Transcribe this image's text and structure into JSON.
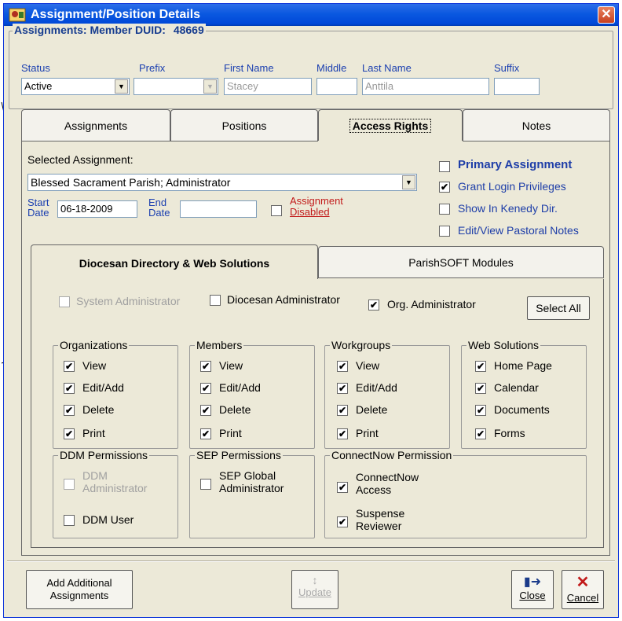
{
  "window": {
    "title": "Assignment/Position Details"
  },
  "header": {
    "member_label": "Assignments: Member DUID:",
    "duid": "48669",
    "status_label": "Status",
    "status_value": "Active",
    "prefix_label": "Prefix",
    "prefix_value": "",
    "first_name_label": "First Name",
    "first_name_value": "Stacey",
    "middle_label": "Middle",
    "middle_value": "",
    "last_name_label": "Last Name",
    "last_name_value": "Anttila",
    "suffix_label": "Suffix",
    "suffix_value": ""
  },
  "tabs": [
    "Assignments",
    "Positions",
    "Access Rights",
    "Notes"
  ],
  "access": {
    "selected_assignment_label": "Selected Assignment:",
    "selected_assignment_value": "Blessed Sacrament Parish; Administrator",
    "start_label_1": "Start",
    "start_label_2": "Date",
    "start_value": "06-18-2009",
    "end_label_1": "End",
    "end_label_2": "Date",
    "end_value": "",
    "assignment_disabled_1": "Assignment",
    "assignment_disabled_2": "Disabled",
    "primary_assignment": "Primary Assignment",
    "grant_login": "Grant Login Privileges",
    "show_kenedy": "Show In Kenedy Dir.",
    "edit_pastoral": "Edit/View Pastoral Notes"
  },
  "subtabs": [
    "Diocesan Directory & Web Solutions",
    "ParishSOFT Modules"
  ],
  "ddws": {
    "system_admin": "System Administrator",
    "diocesan_admin": "Diocesan Administrator",
    "org_admin": "Org. Administrator",
    "select_all": "Select All",
    "groups": {
      "organizations": {
        "title": "Organizations",
        "items": [
          "View",
          "Edit/Add",
          "Delete",
          "Print"
        ]
      },
      "members": {
        "title": "Members",
        "items": [
          "View",
          "Edit/Add",
          "Delete",
          "Print"
        ]
      },
      "workgroups": {
        "title": "Workgroups",
        "items": [
          "View",
          "Edit/Add",
          "Delete",
          "Print"
        ]
      },
      "web_solutions": {
        "title": "Web Solutions",
        "items": [
          "Home Page",
          "Calendar",
          "Documents",
          "Forms"
        ]
      }
    },
    "ddm": {
      "title": "DDM Permissions",
      "admin_1": "DDM",
      "admin_2": "Administrator",
      "user": "DDM User"
    },
    "sep": {
      "title": "SEP Permissions",
      "global_1": "SEP Global",
      "global_2": "Administrator"
    },
    "connectnow": {
      "title": "ConnectNow Permission",
      "access_1": "ConnectNow",
      "access_2": "Access",
      "suspense_1": "Suspense",
      "suspense_2": "Reviewer"
    }
  },
  "footer": {
    "add_1": "Add Additional",
    "add_2": "Assignments",
    "update": "Update",
    "close": "Close",
    "cancel": "Cancel"
  },
  "check_mark": "✔"
}
